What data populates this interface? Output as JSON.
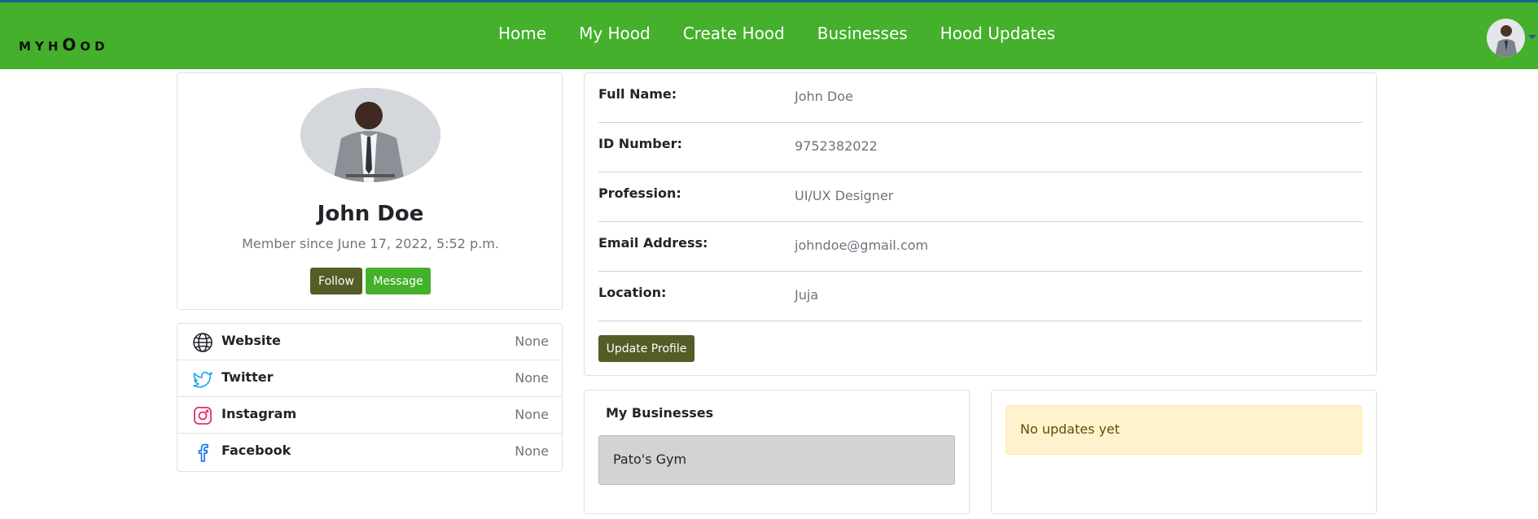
{
  "brand": {
    "text_small_1": "M",
    "text_small_2": "Y",
    "text_small_3": "H",
    "text_big": "O",
    "text_small_4": "O",
    "text_small_5": "D"
  },
  "nav": {
    "links": [
      {
        "label": "Home"
      },
      {
        "label": "My Hood"
      },
      {
        "label": "Create Hood"
      },
      {
        "label": "Businesses"
      },
      {
        "label": "Hood Updates"
      }
    ]
  },
  "profile": {
    "name": "John Doe",
    "member_since": "Member since June 17, 2022, 5:52 p.m.",
    "follow_label": "Follow",
    "message_label": "Message"
  },
  "social": [
    {
      "label": "Website",
      "value": "None",
      "icon": "globe-icon"
    },
    {
      "label": "Twitter",
      "value": "None",
      "icon": "twitter-icon"
    },
    {
      "label": "Instagram",
      "value": "None",
      "icon": "instagram-icon"
    },
    {
      "label": "Facebook",
      "value": "None",
      "icon": "facebook-icon"
    }
  ],
  "details": {
    "rows": [
      {
        "label": "Full Name:",
        "value": "John Doe"
      },
      {
        "label": "ID Number:",
        "value": "9752382022"
      },
      {
        "label": "Profession:",
        "value": "UI/UX Designer"
      },
      {
        "label": "Email Address:",
        "value": "johndoe@gmail.com"
      },
      {
        "label": "Location:",
        "value": "Juja"
      }
    ],
    "update_label": "Update Profile"
  },
  "businesses": {
    "title": "My Businesses",
    "items": [
      {
        "name": "Pato's Gym"
      }
    ]
  },
  "updates": {
    "empty_text": "No updates yet"
  },
  "colors": {
    "navbar": "#44b02b",
    "accent_dark": "#555c26",
    "alert_bg": "#fff3cd"
  }
}
